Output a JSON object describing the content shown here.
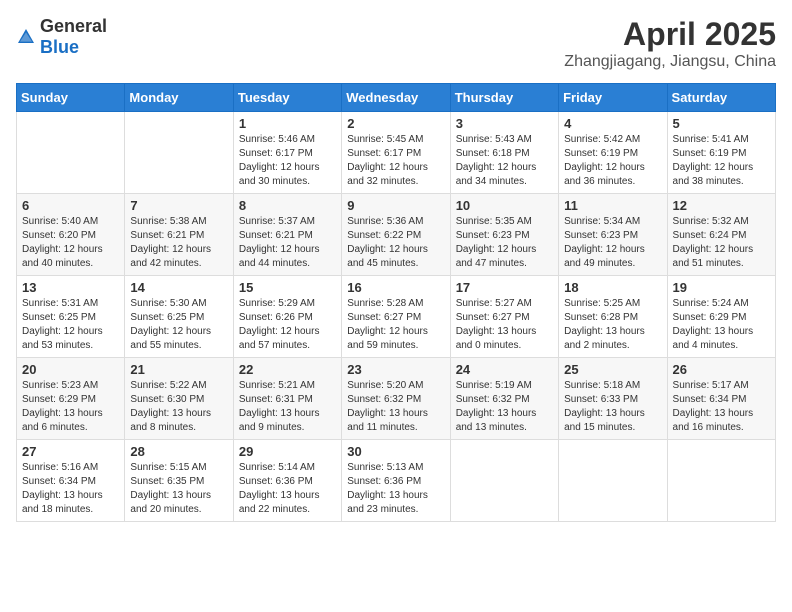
{
  "header": {
    "logo_general": "General",
    "logo_blue": "Blue",
    "month_title": "April 2025",
    "location": "Zhangjiagang, Jiangsu, China"
  },
  "days_of_week": [
    "Sunday",
    "Monday",
    "Tuesday",
    "Wednesday",
    "Thursday",
    "Friday",
    "Saturday"
  ],
  "weeks": [
    [
      {
        "day": "",
        "info": ""
      },
      {
        "day": "",
        "info": ""
      },
      {
        "day": "1",
        "info": "Sunrise: 5:46 AM\nSunset: 6:17 PM\nDaylight: 12 hours and 30 minutes."
      },
      {
        "day": "2",
        "info": "Sunrise: 5:45 AM\nSunset: 6:17 PM\nDaylight: 12 hours and 32 minutes."
      },
      {
        "day": "3",
        "info": "Sunrise: 5:43 AM\nSunset: 6:18 PM\nDaylight: 12 hours and 34 minutes."
      },
      {
        "day": "4",
        "info": "Sunrise: 5:42 AM\nSunset: 6:19 PM\nDaylight: 12 hours and 36 minutes."
      },
      {
        "day": "5",
        "info": "Sunrise: 5:41 AM\nSunset: 6:19 PM\nDaylight: 12 hours and 38 minutes."
      }
    ],
    [
      {
        "day": "6",
        "info": "Sunrise: 5:40 AM\nSunset: 6:20 PM\nDaylight: 12 hours and 40 minutes."
      },
      {
        "day": "7",
        "info": "Sunrise: 5:38 AM\nSunset: 6:21 PM\nDaylight: 12 hours and 42 minutes."
      },
      {
        "day": "8",
        "info": "Sunrise: 5:37 AM\nSunset: 6:21 PM\nDaylight: 12 hours and 44 minutes."
      },
      {
        "day": "9",
        "info": "Sunrise: 5:36 AM\nSunset: 6:22 PM\nDaylight: 12 hours and 45 minutes."
      },
      {
        "day": "10",
        "info": "Sunrise: 5:35 AM\nSunset: 6:23 PM\nDaylight: 12 hours and 47 minutes."
      },
      {
        "day": "11",
        "info": "Sunrise: 5:34 AM\nSunset: 6:23 PM\nDaylight: 12 hours and 49 minutes."
      },
      {
        "day": "12",
        "info": "Sunrise: 5:32 AM\nSunset: 6:24 PM\nDaylight: 12 hours and 51 minutes."
      }
    ],
    [
      {
        "day": "13",
        "info": "Sunrise: 5:31 AM\nSunset: 6:25 PM\nDaylight: 12 hours and 53 minutes."
      },
      {
        "day": "14",
        "info": "Sunrise: 5:30 AM\nSunset: 6:25 PM\nDaylight: 12 hours and 55 minutes."
      },
      {
        "day": "15",
        "info": "Sunrise: 5:29 AM\nSunset: 6:26 PM\nDaylight: 12 hours and 57 minutes."
      },
      {
        "day": "16",
        "info": "Sunrise: 5:28 AM\nSunset: 6:27 PM\nDaylight: 12 hours and 59 minutes."
      },
      {
        "day": "17",
        "info": "Sunrise: 5:27 AM\nSunset: 6:27 PM\nDaylight: 13 hours and 0 minutes."
      },
      {
        "day": "18",
        "info": "Sunrise: 5:25 AM\nSunset: 6:28 PM\nDaylight: 13 hours and 2 minutes."
      },
      {
        "day": "19",
        "info": "Sunrise: 5:24 AM\nSunset: 6:29 PM\nDaylight: 13 hours and 4 minutes."
      }
    ],
    [
      {
        "day": "20",
        "info": "Sunrise: 5:23 AM\nSunset: 6:29 PM\nDaylight: 13 hours and 6 minutes."
      },
      {
        "day": "21",
        "info": "Sunrise: 5:22 AM\nSunset: 6:30 PM\nDaylight: 13 hours and 8 minutes."
      },
      {
        "day": "22",
        "info": "Sunrise: 5:21 AM\nSunset: 6:31 PM\nDaylight: 13 hours and 9 minutes."
      },
      {
        "day": "23",
        "info": "Sunrise: 5:20 AM\nSunset: 6:32 PM\nDaylight: 13 hours and 11 minutes."
      },
      {
        "day": "24",
        "info": "Sunrise: 5:19 AM\nSunset: 6:32 PM\nDaylight: 13 hours and 13 minutes."
      },
      {
        "day": "25",
        "info": "Sunrise: 5:18 AM\nSunset: 6:33 PM\nDaylight: 13 hours and 15 minutes."
      },
      {
        "day": "26",
        "info": "Sunrise: 5:17 AM\nSunset: 6:34 PM\nDaylight: 13 hours and 16 minutes."
      }
    ],
    [
      {
        "day": "27",
        "info": "Sunrise: 5:16 AM\nSunset: 6:34 PM\nDaylight: 13 hours and 18 minutes."
      },
      {
        "day": "28",
        "info": "Sunrise: 5:15 AM\nSunset: 6:35 PM\nDaylight: 13 hours and 20 minutes."
      },
      {
        "day": "29",
        "info": "Sunrise: 5:14 AM\nSunset: 6:36 PM\nDaylight: 13 hours and 22 minutes."
      },
      {
        "day": "30",
        "info": "Sunrise: 5:13 AM\nSunset: 6:36 PM\nDaylight: 13 hours and 23 minutes."
      },
      {
        "day": "",
        "info": ""
      },
      {
        "day": "",
        "info": ""
      },
      {
        "day": "",
        "info": ""
      }
    ]
  ]
}
